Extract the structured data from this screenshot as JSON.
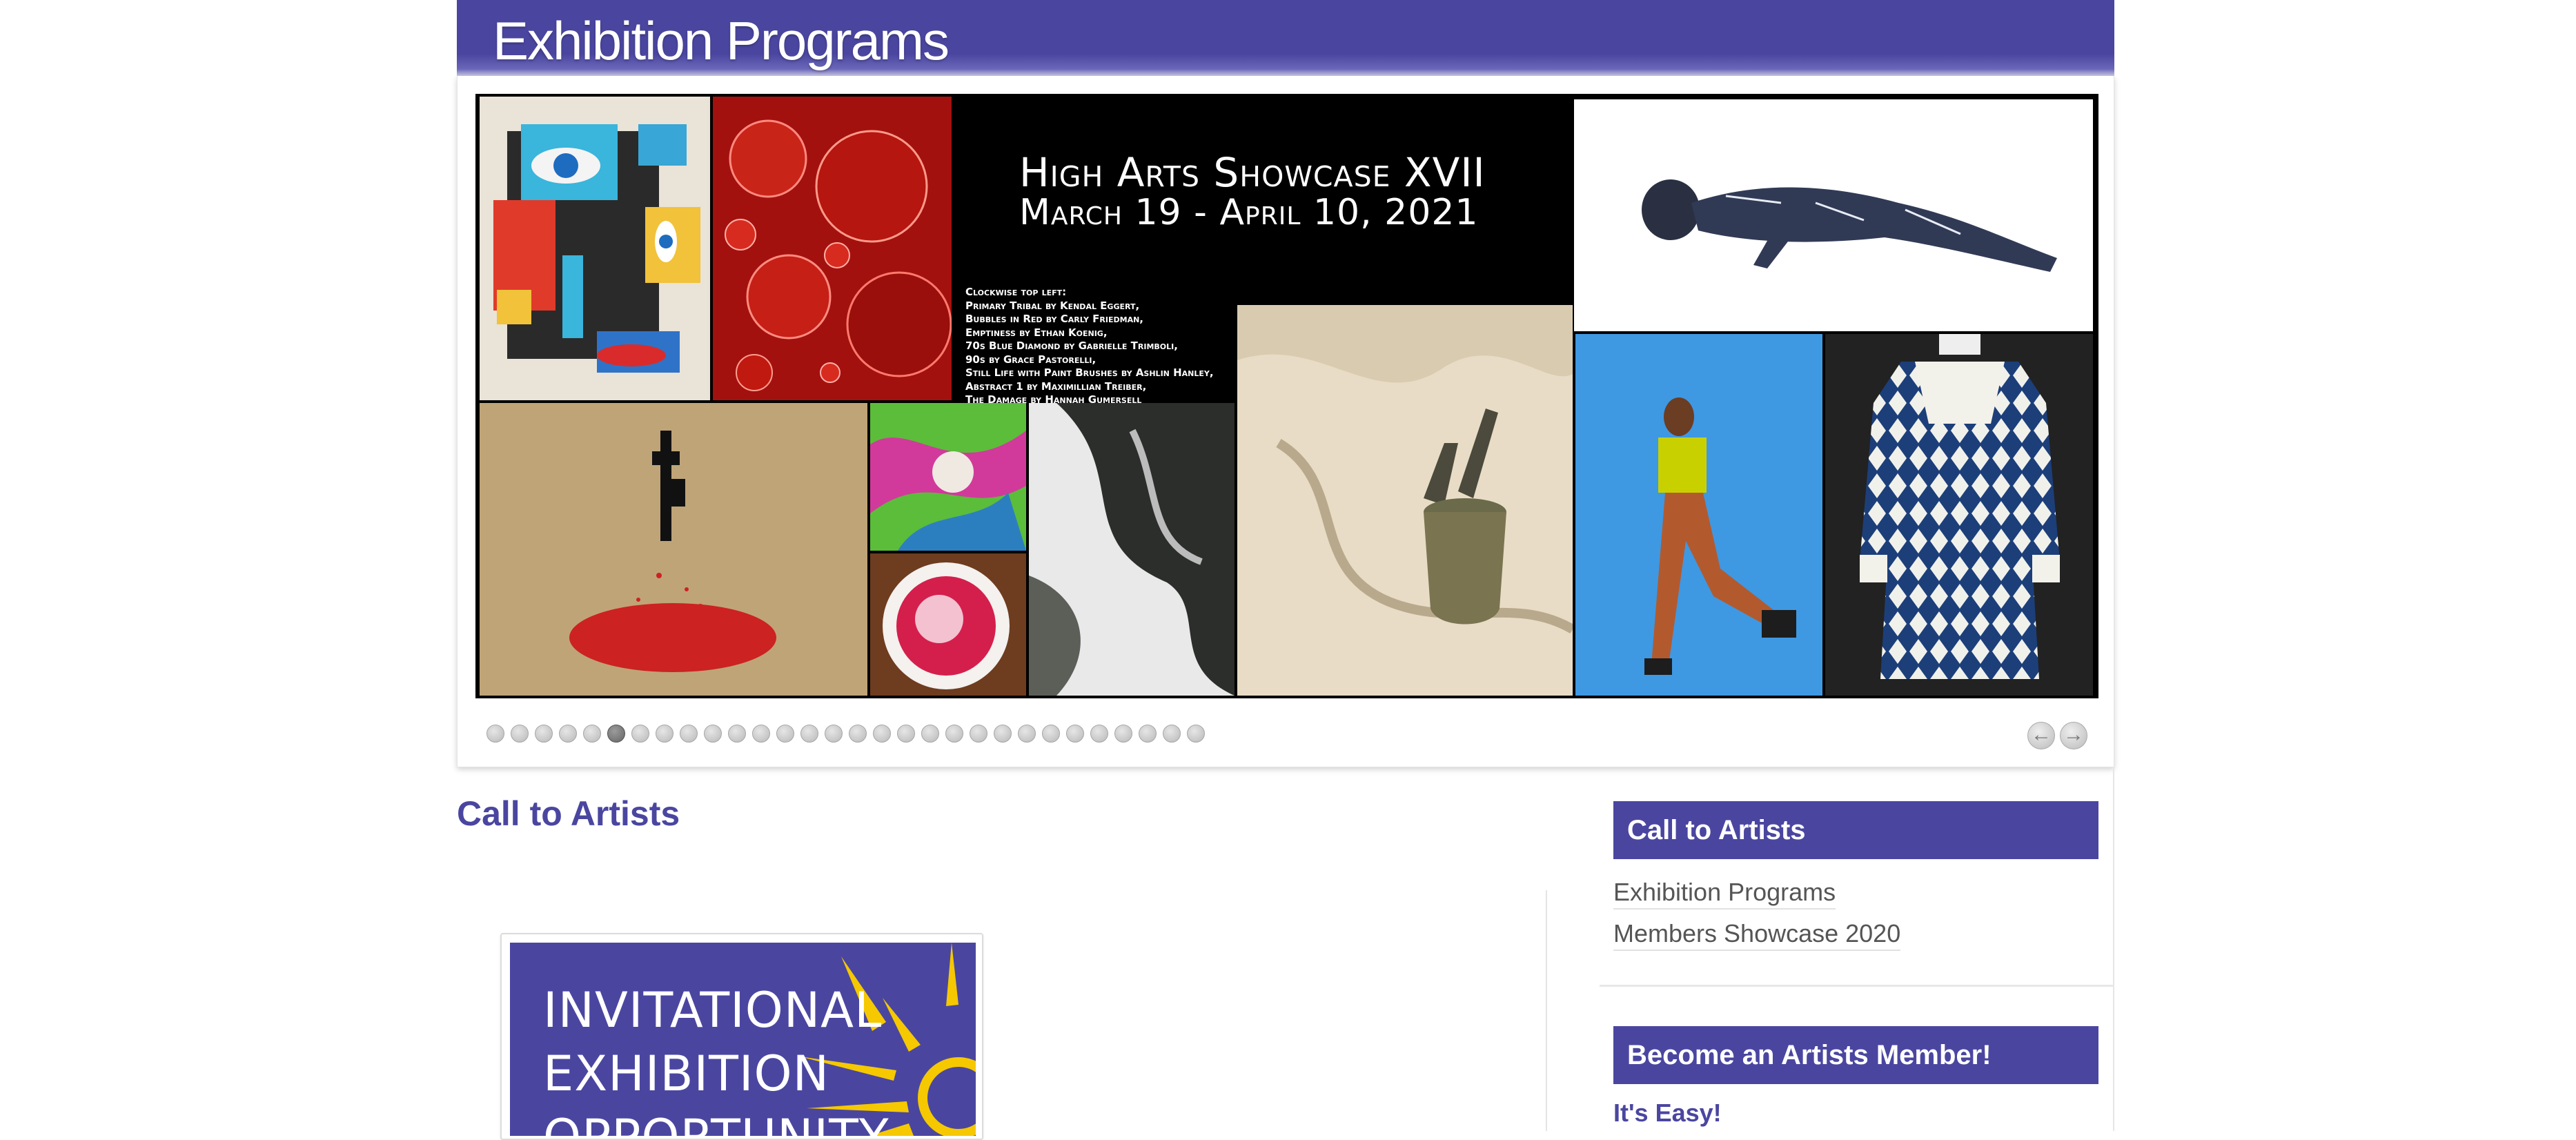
{
  "header": {
    "title": "Exhibition Programs"
  },
  "slideshow": {
    "poster_title": "High Arts Showcase XVII",
    "poster_dates": "March 19 - April 10, 2021",
    "credits": [
      "Clockwise top left:",
      "Primary Tribal by Kendal Eggert,",
      "Bubbles in Red by Carly Friedman,",
      "Emptiness by Ethan Koenig,",
      "70s Blue Diamond by Gabrielle Trimboli,",
      "90s by Grace Pastorelli,",
      "Still Life with Paint Brushes by Ashlin Hanley,",
      "Abstract 1 by Maximillian Treiber,",
      "The Damage by Hannah Gumersell"
    ],
    "dot_count": 30,
    "active_dot": 5,
    "prev_icon": "arrow-left-icon",
    "next_icon": "arrow-right-icon"
  },
  "main": {
    "title": "Call to Artists",
    "card_text": "INVITATIONAL\nEXHIBITION\nOPPORTUNITY"
  },
  "sidebar": {
    "section1_title": "Call to Artists",
    "links": [
      "Exhibition Programs",
      "Members Showcase 2020"
    ],
    "section2_title": "Become an Artists Member!",
    "easy_label": "It's Easy!"
  },
  "colors": {
    "brand": "#4a46a0",
    "accent_yellow": "#f5c800"
  }
}
